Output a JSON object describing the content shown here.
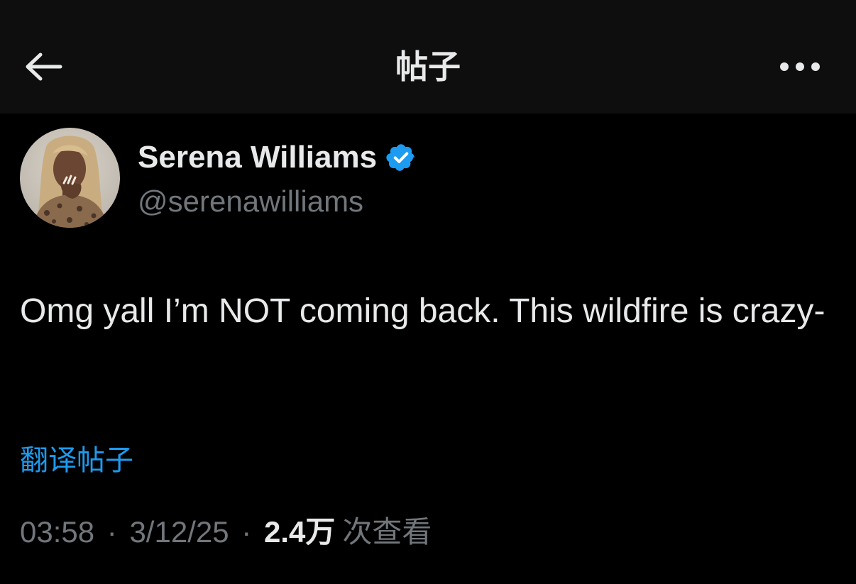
{
  "header": {
    "title": "帖子",
    "back_icon": "arrow-left-icon",
    "more_icon": "more-horizontal-icon"
  },
  "author": {
    "name": "Serena Williams",
    "handle": "@serenawilliams",
    "verified": true,
    "verified_color": "#1d9bf0"
  },
  "tweet": {
    "text": "Omg yall I’m NOT coming back. This wildfire is crazy-",
    "translate_label": "翻译帖子"
  },
  "meta": {
    "time": "03:58",
    "separator": "·",
    "date": "3/12/25",
    "views_count": "2.4万",
    "views_label": "次查看"
  },
  "colors": {
    "background": "#000000",
    "header_background": "#0e0e0e",
    "text_primary": "#e7e9ea",
    "text_secondary": "#71767b",
    "accent": "#1d9bf0"
  }
}
